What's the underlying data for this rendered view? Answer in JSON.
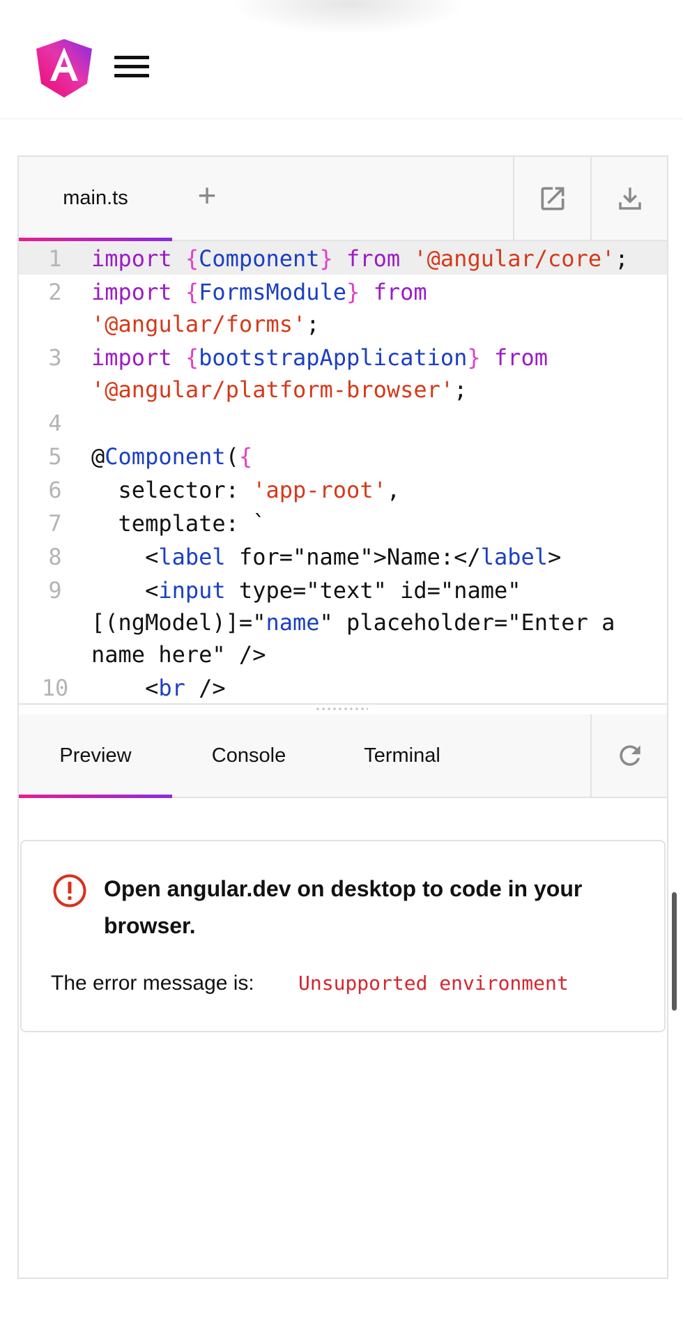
{
  "header": {
    "logo_icon": "angular-logo-icon",
    "menu_icon": "hamburger-menu-icon"
  },
  "editor": {
    "file_tabs": [
      {
        "label": "main.ts",
        "active": true
      }
    ],
    "add_tab_label": "+",
    "actions": [
      {
        "name": "open-external-icon"
      },
      {
        "name": "download-icon"
      }
    ],
    "code_lines": [
      {
        "n": "1",
        "html": "<span class=\"k\">import</span> <span class=\"b\">{</span><span class=\"t\">Component</span><span class=\"b\">}</span> <span class=\"k\">from</span> <span class=\"s\">'@angular/core'</span>;"
      },
      {
        "n": "2",
        "html": "<span class=\"k\">import</span> <span class=\"b\">{</span><span class=\"t\">FormsModule</span><span class=\"b\">}</span> <span class=\"k\">from</span> <span class=\"s\">'@angular/forms'</span>;"
      },
      {
        "n": "3",
        "html": "<span class=\"k\">import</span> <span class=\"b\">{</span><span class=\"t\">bootstrapApplication</span><span class=\"b\">}</span> <span class=\"k\">from</span> <span class=\"s\">'@angular/platform-browser'</span>;"
      },
      {
        "n": "4",
        "html": " "
      },
      {
        "n": "5",
        "html": "@<span class=\"t\">Component</span>(<span class=\"b\">{</span>"
      },
      {
        "n": "6",
        "html": "  selector: <span class=\"s\">'app-root'</span>,"
      },
      {
        "n": "7",
        "html": "  template: `"
      },
      {
        "n": "8",
        "html": "    &lt;<span class=\"t\">label</span> for=\"name\"&gt;Name:&lt;/<span class=\"t\">label</span>&gt;"
      },
      {
        "n": "9",
        "html": "    &lt;<span class=\"t\">input</span> type=\"text\" id=\"name\" [(ngModel)]=\"<span class=\"t\">name</span>\" placeholder=\"Enter a name here\" /&gt;"
      },
      {
        "n": "10",
        "html": "    &lt;<span class=\"t\">br</span> /&gt;"
      }
    ],
    "highlighted_line": "1"
  },
  "panel": {
    "tabs": [
      {
        "label": "Preview",
        "active": true
      },
      {
        "label": "Console",
        "active": false
      },
      {
        "label": "Terminal",
        "active": false
      }
    ],
    "refresh_icon": "refresh-icon"
  },
  "message": {
    "icon": "error-circle-icon",
    "title": "Open angular.dev on desktop to code in your browser.",
    "label": "The error message is:",
    "error": "Unsupported environment"
  },
  "colors": {
    "accent_start": "#e91e8c",
    "accent_end": "#8a2be2",
    "error_red": "#d4262e",
    "keyword": "#9b1cc4",
    "type": "#1b3fc4",
    "string": "#d43a1a"
  }
}
